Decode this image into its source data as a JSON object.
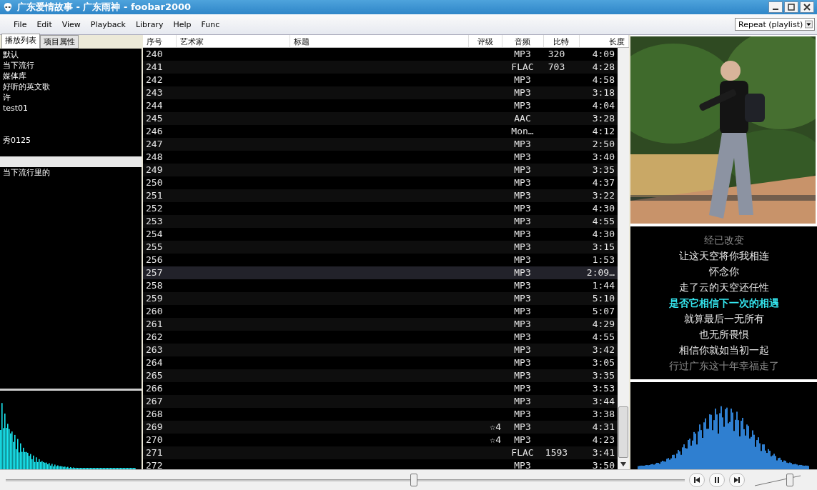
{
  "window": {
    "title": "广东爱情故事 - 广东雨神 - foobar2000"
  },
  "menu": [
    "File",
    "Edit",
    "View",
    "Playback",
    "Library",
    "Help",
    "Func"
  ],
  "order_dropdown": {
    "value": "Repeat (playlist)"
  },
  "left_tabs": [
    {
      "label": "播放列表",
      "selected": true
    },
    {
      "label": "项目属性",
      "selected": false
    }
  ],
  "playlists": [
    {
      "label": "默认",
      "selected": false
    },
    {
      "label": "当下流行",
      "selected": false
    },
    {
      "label": "媒体库",
      "selected": false
    },
    {
      "label": "好听的英文歌",
      "selected": false
    },
    {
      "label": "许",
      "selected": false
    },
    {
      "label": "test01",
      "selected": false
    },
    {
      "selected": false
    },
    {
      "selected": false
    },
    {
      "label": "秀0125",
      "selected": false
    },
    {
      "selected": false
    },
    {
      "selected": true
    },
    {
      "label": "当下流行里的",
      "selected": false
    }
  ],
  "table": {
    "columns": [
      "序号",
      "艺术家",
      "标题",
      "评级",
      "音频",
      "比特",
      "长度"
    ],
    "rows": [
      {
        "no": "240",
        "codec": "MP3",
        "bitrate": "320",
        "length": "4:09",
        "playing": false
      },
      {
        "no": "241",
        "codec": "FLAC",
        "bitrate": "703",
        "length": "4:28",
        "playing": false
      },
      {
        "no": "242",
        "codec": "MP3",
        "length": "4:58",
        "playing": false
      },
      {
        "no": "243",
        "codec": "MP3",
        "length": "3:18",
        "playing": false
      },
      {
        "no": "244",
        "codec": "MP3",
        "length": "4:04",
        "playing": false
      },
      {
        "no": "245",
        "codec": "AAC",
        "length": "3:28",
        "playing": false
      },
      {
        "no": "246",
        "codec": "Mon…",
        "length": "4:12",
        "playing": false
      },
      {
        "no": "247",
        "codec": "MP3",
        "length": "2:50",
        "playing": false
      },
      {
        "no": "248",
        "codec": "MP3",
        "length": "3:40",
        "playing": false
      },
      {
        "no": "249",
        "codec": "MP3",
        "length": "3:35",
        "playing": false
      },
      {
        "no": "250",
        "codec": "MP3",
        "length": "4:37",
        "playing": false
      },
      {
        "no": "251",
        "codec": "MP3",
        "length": "3:22",
        "playing": false
      },
      {
        "no": "252",
        "codec": "MP3",
        "length": "4:30",
        "playing": false
      },
      {
        "no": "253",
        "codec": "MP3",
        "length": "4:55",
        "playing": false
      },
      {
        "no": "254",
        "codec": "MP3",
        "length": "4:30",
        "playing": false
      },
      {
        "no": "255",
        "codec": "MP3",
        "length": "3:15",
        "playing": false
      },
      {
        "no": "256",
        "codec": "MP3",
        "length": "1:53",
        "playing": false
      },
      {
        "no": "257",
        "codec": "MP3",
        "length": "2:09…",
        "playing": true
      },
      {
        "no": "258",
        "codec": "MP3",
        "length": "1:44",
        "playing": false
      },
      {
        "no": "259",
        "codec": "MP3",
        "length": "5:10",
        "playing": false
      },
      {
        "no": "260",
        "codec": "MP3",
        "length": "5:07",
        "playing": false
      },
      {
        "no": "261",
        "codec": "MP3",
        "length": "4:29",
        "playing": false
      },
      {
        "no": "262",
        "codec": "MP3",
        "length": "4:55",
        "playing": false
      },
      {
        "no": "263",
        "codec": "MP3",
        "length": "3:42",
        "playing": false
      },
      {
        "no": "264",
        "codec": "MP3",
        "length": "3:05",
        "playing": false
      },
      {
        "no": "265",
        "codec": "MP3",
        "length": "3:35",
        "playing": false
      },
      {
        "no": "266",
        "codec": "MP3",
        "length": "3:53",
        "playing": false
      },
      {
        "no": "267",
        "codec": "MP3",
        "length": "3:44",
        "playing": false
      },
      {
        "no": "268",
        "codec": "MP3",
        "length": "3:38",
        "playing": false
      },
      {
        "no": "269",
        "rating": "☆4",
        "codec": "MP3",
        "length": "4:31",
        "playing": false
      },
      {
        "no": "270",
        "rating": "☆4",
        "codec": "MP3",
        "length": "4:23",
        "playing": false
      },
      {
        "no": "271",
        "codec": "FLAC",
        "bitrate": "1593",
        "length": "3:41",
        "playing": false
      },
      {
        "no": "272",
        "codec": "MP3",
        "length": "3:50",
        "playing": false
      }
    ]
  },
  "lyrics": [
    {
      "text": "经已改变",
      "kind": "dim"
    },
    {
      "text": "让这天空将你我相连",
      "kind": "normal"
    },
    {
      "text": "怀念你",
      "kind": "normal"
    },
    {
      "text": "走了云的天空还任性",
      "kind": "normal"
    },
    {
      "text": "是否它相信下一次的相遇",
      "kind": "current"
    },
    {
      "text": "就算最后一无所有",
      "kind": "normal"
    },
    {
      "text": "也无所畏惧",
      "kind": "normal"
    },
    {
      "text": "相信你就如当初一起",
      "kind": "normal"
    },
    {
      "text": "行过广东这十年幸福走了",
      "kind": "dim"
    }
  ],
  "seekbar": {
    "level": 0.6
  },
  "volume": {
    "level": 0.75
  }
}
